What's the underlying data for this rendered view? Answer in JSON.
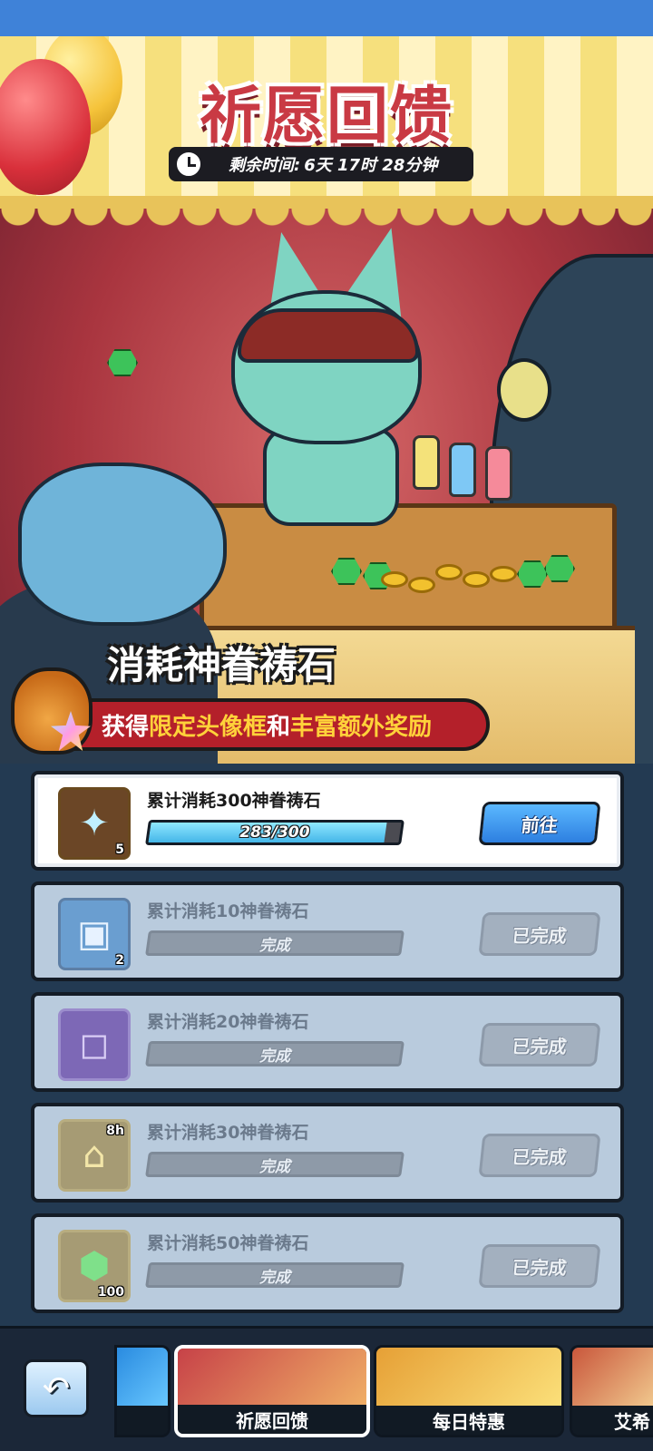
{
  "header": {
    "title": "祈愿回馈",
    "timer_label": "剩余时间:",
    "timer_value": "6天 17时 28分钟"
  },
  "promo": {
    "headline": "消耗神眷祷石",
    "reward_prefix": "获得",
    "reward_highlight_1": "限定头像框",
    "reward_joiner": "和",
    "reward_highlight_2": "丰富额外奖励"
  },
  "tasks": [
    {
      "name": "累计消耗300神眷祷石",
      "progress_text": "283/300",
      "progress": 0.943,
      "button": "前往",
      "state": "active",
      "icon": "star-crystal-icon",
      "count": "5"
    },
    {
      "name": "累计消耗10神眷祷石",
      "progress_text": "完成",
      "progress": 1,
      "button": "已完成",
      "state": "done",
      "icon": "chest-icon",
      "count": "2"
    },
    {
      "name": "累计消耗20神眷祷石",
      "progress_text": "完成",
      "progress": 1,
      "button": "已完成",
      "state": "done",
      "icon": "avatar-frame-icon",
      "count": ""
    },
    {
      "name": "累计消耗30神眷祷石",
      "progress_text": "完成",
      "progress": 1,
      "button": "已完成",
      "state": "done",
      "icon": "time-chest-icon",
      "count": "",
      "badge": "8h"
    },
    {
      "name": "累计消耗50神眷祷石",
      "progress_text": "完成",
      "progress": 1,
      "button": "已完成",
      "state": "done",
      "icon": "green-gem-icon",
      "count": "100"
    }
  ],
  "tabs": [
    {
      "label": "",
      "selected": false
    },
    {
      "label": "祈愿回馈",
      "selected": true
    },
    {
      "label": "每日特惠",
      "selected": false
    },
    {
      "label": "艾希",
      "selected": false
    }
  ],
  "colors": {
    "accent_blue": "#3f82d8",
    "title_red": "#c93a44",
    "highlight_yellow": "#ffd23a",
    "panel_dark": "#233a52"
  }
}
